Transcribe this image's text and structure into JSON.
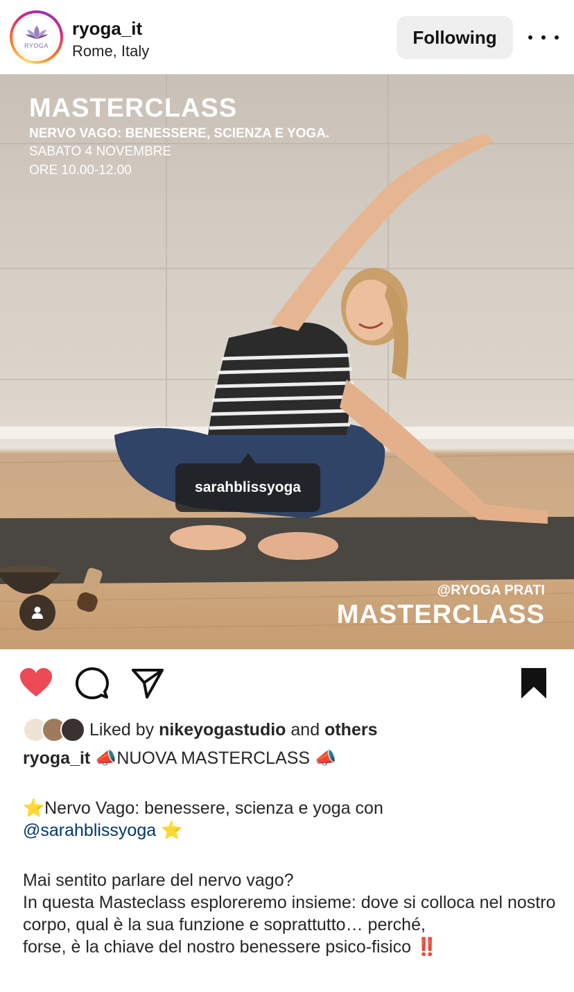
{
  "post": {
    "username": "ryoga_it",
    "location": "Rome, Italy",
    "follow_label": "Following",
    "avatar_text": "RYOGA"
  },
  "photo": {
    "overlay_title": "MASTERCLASS",
    "overlay_subtitle": "NERVO VAGO: BENESSERE, SCIENZA E YOGA.",
    "overlay_date": "SABATO 4 NOVEMBRE",
    "overlay_time": "ORE 10.00-12.00",
    "overlay_handle": "@RYOGA PRATI",
    "overlay_brand": "MASTERCLASS",
    "tag_label": "sarahblissyoga"
  },
  "likes": {
    "prefix": "Liked by",
    "first_liker": "nikeyogastudio",
    "conjunction": "and",
    "others": "others"
  },
  "caption": {
    "username": "ryoga_it",
    "line1": " 📣NUOVA MASTERCLASS 📣",
    "line2": "⭐️Nervo Vago: benessere, scienza e yoga con",
    "mention": "@sarahblissyoga",
    "line2_end": " ⭐️",
    "line3": "Mai sentito parlare del nervo vago?",
    "line4": "In questa Masteclass esploreremo insieme: dove si colloca nel nostro corpo, qual è la sua funzione e soprattutto… perché,",
    "line5": "forse, è la chiave del nostro benessere psico-fisico ‼️"
  },
  "colors": {
    "heart": "#ed4956",
    "mention": "#00376b",
    "button_bg": "#efefef"
  },
  "icons": [
    "more-icon",
    "heart-icon",
    "comment-icon",
    "share-icon",
    "bookmark-icon",
    "user-tag-icon"
  ]
}
